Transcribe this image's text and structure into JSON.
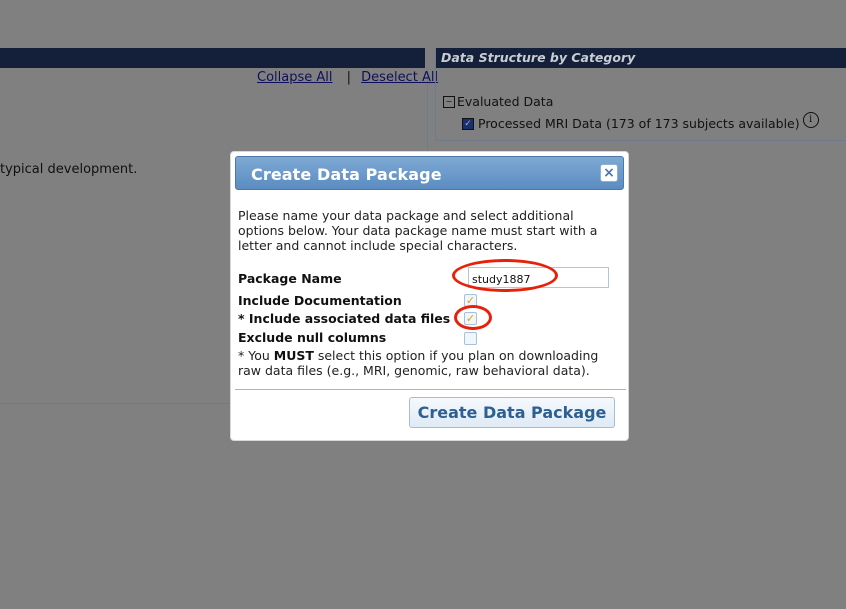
{
  "background": {
    "links": {
      "collapse_all": "Collapse All",
      "separator": "|",
      "deselect_all": "Deselect All"
    },
    "description_fragment": "typical development.",
    "right_panel": {
      "title": "Data Structure by Category",
      "tree": [
        {
          "label": "Evaluated Data"
        },
        {
          "label": "Processed MRI Data (173 of 173 subjects available)"
        }
      ],
      "info_symbol": "i"
    }
  },
  "modal": {
    "title": "Create Data Package",
    "close_symbol": "×",
    "intro": "Please name your data package and select additional options below. Your data package name must start with a letter and cannot include special characters.",
    "fields": {
      "package_name_label": "Package Name",
      "package_name_value": "study1887",
      "include_documentation_label": "Include Documentation",
      "include_documentation_checked": true,
      "include_associated_label": "* Include associated data files",
      "include_associated_checked": true,
      "exclude_null_label": "Exclude null columns",
      "exclude_null_checked": false
    },
    "footnote": {
      "prefix": "* You ",
      "emphasis": "MUST",
      "suffix": " select this option if you plan on downloading raw data files (e.g., MRI, genomic, raw behavioral data)."
    },
    "submit_label": "Create Data Package"
  },
  "colors": {
    "overlay": "#808080",
    "header_gradient_top": "#7ea9d4",
    "header_gradient_bottom": "#5b8cc1",
    "annotation_red": "#e8200a",
    "check_gold": "#d9a500"
  },
  "icons": {
    "check": "✓",
    "minus_box": "−"
  }
}
